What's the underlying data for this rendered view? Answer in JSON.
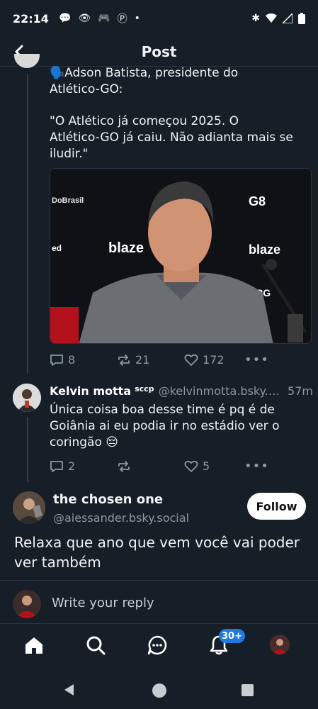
{
  "status": {
    "time": "22:14"
  },
  "header": {
    "title": "Post"
  },
  "parent_post": {
    "line1": "🗣️Adson Batista, presidente do",
    "line2": "Atlético-GO:",
    "quote1": "\"O Atlético já começou 2025. O",
    "quote2": "Atlético-GO já caiu. Não adianta mais se",
    "quote3": "iludir.\"",
    "image_texts": {
      "dobrasil": "DoBrasil",
      "g8": "G8",
      "blaze1": "blaze",
      "blaze2": "blaze",
      "brg": "BRG",
      "ed": "ed"
    },
    "replies": "8",
    "reposts": "21",
    "likes": "172"
  },
  "reply": {
    "name": "Kelvin motta",
    "badge": "sccp",
    "handle": "@kelvinmotta.bsky.s...",
    "time": "57m",
    "line1": "Única coisa boa desse time é pq é de",
    "line2": "Goiânia ai eu podia ir no estádio ver o",
    "line3": "coringão 😔",
    "replies": "2",
    "reposts": "",
    "likes": "5"
  },
  "main_post": {
    "name": "the chosen one",
    "handle": "@aiessander.bsky.social",
    "follow_label": "Follow",
    "line1": "Relaxa que ano que vem você vai poder",
    "line2": "ver também"
  },
  "reply_bar": {
    "placeholder": "Write your reply"
  },
  "tabbar": {
    "notifications_badge": "30+"
  },
  "colors": {
    "background": "#161e27",
    "accent": "#1f7ae0",
    "muted": "#8a98a8"
  }
}
